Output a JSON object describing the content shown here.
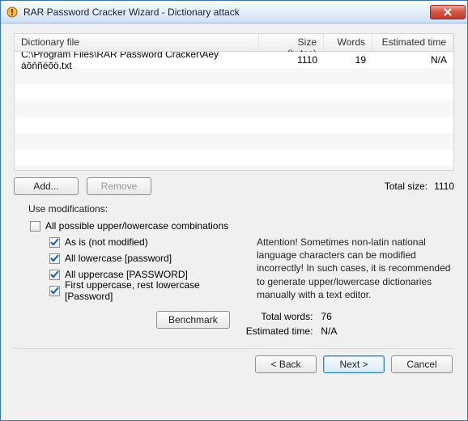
{
  "window": {
    "title": "RAR Password Cracker Wizard - Dictionary attack"
  },
  "grid": {
    "headers": {
      "file": "Dictionary file",
      "size": "Size (bytes)",
      "words": "Words",
      "eta": "Estimated time"
    },
    "rows": [
      {
        "file": "C:\\Program Files\\RAR Password Cracker\\Äëÿ áõňñëõö.txt",
        "size": "1110",
        "words": "19",
        "eta": "N/A"
      }
    ]
  },
  "buttons": {
    "add": "Add...",
    "remove": "Remove",
    "benchmark": "Benchmark",
    "back": "< Back",
    "next": "Next >",
    "cancel": "Cancel"
  },
  "labels": {
    "total_size": "Total size:",
    "use_modifications": "Use modifications:",
    "all_combos": "All possible upper/lowercase combinations",
    "as_is": "As is (not modified)",
    "all_lower": "All lowercase [password]",
    "all_upper": "All uppercase [PASSWORD]",
    "first_upper": "First uppercase, rest lowercase [Password]",
    "warning": "Attention! Sometimes non-latin national language characters can be modified incorrectly! In such cases, it is recommended to generate upper/lowercase dictionaries manually with a text editor.",
    "total_words": "Total words:",
    "estimated_time": "Estimated  time:"
  },
  "values": {
    "total_size": "1110",
    "total_words": "76",
    "estimated_time": "N/A"
  },
  "checks": {
    "all_combos": false,
    "as_is": true,
    "all_lower": true,
    "all_upper": true,
    "first_upper": true
  }
}
